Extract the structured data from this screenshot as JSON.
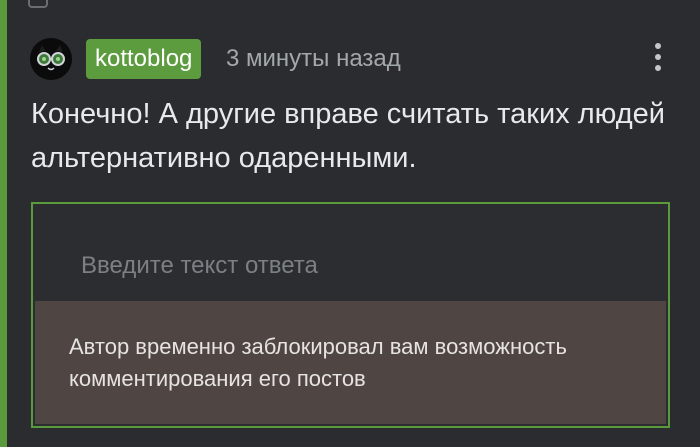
{
  "comment": {
    "author": "kottoblog",
    "timestamp": "3 минуты назад",
    "avatar_icon": "cat-with-glasses-avatar",
    "more_icon": "vertical-dots-icon",
    "text": "Конечно! А другие вправе считать таких людей альтернативно одаренными."
  },
  "reply": {
    "placeholder": "Введите текст ответа",
    "blocked_message": "Автор временно заблокировал вам возможность комментирования его постов"
  },
  "colors": {
    "background": "#2a2c2f",
    "accent": "#5c9b3e",
    "notice_background": "#4f4543"
  }
}
